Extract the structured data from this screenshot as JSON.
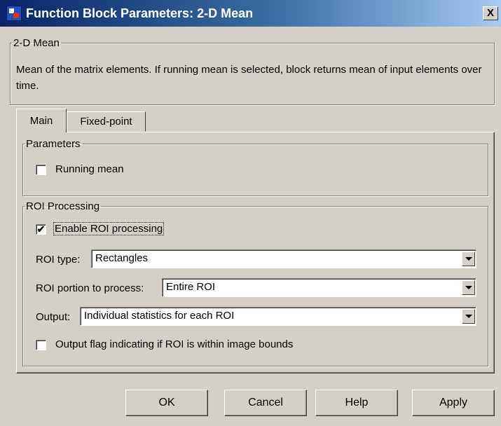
{
  "window": {
    "title": "Function Block Parameters: 2-D Mean",
    "close_glyph": "X",
    "icon": "simulink-block-icon"
  },
  "description_group": {
    "title": "2-D Mean",
    "text": "Mean of the matrix elements. If running mean is selected, block returns mean of input elements over time."
  },
  "tabs": [
    {
      "label": "Main",
      "active": true
    },
    {
      "label": "Fixed-point",
      "active": false
    }
  ],
  "parameters": {
    "title": "Parameters",
    "running_mean": {
      "label": "Running mean",
      "checked": false
    }
  },
  "roi": {
    "title": "ROI Processing",
    "enable": {
      "label": "Enable ROI processing",
      "checked": true,
      "check_glyph": "✔"
    },
    "type": {
      "label": "ROI type:",
      "value": "Rectangles"
    },
    "portion": {
      "label": "ROI portion to process:",
      "value": "Entire ROI"
    },
    "output": {
      "label": "Output:",
      "value": "Individual statistics for each ROI"
    },
    "flag": {
      "label": "Output flag indicating if ROI is within image bounds",
      "checked": false
    }
  },
  "buttons": {
    "ok": "OK",
    "cancel": "Cancel",
    "help": "Help",
    "apply": "Apply"
  },
  "colors": {
    "dialog_bg": "#d4d0c8",
    "title_start": "#0a246a",
    "title_end": "#a6caf0"
  }
}
